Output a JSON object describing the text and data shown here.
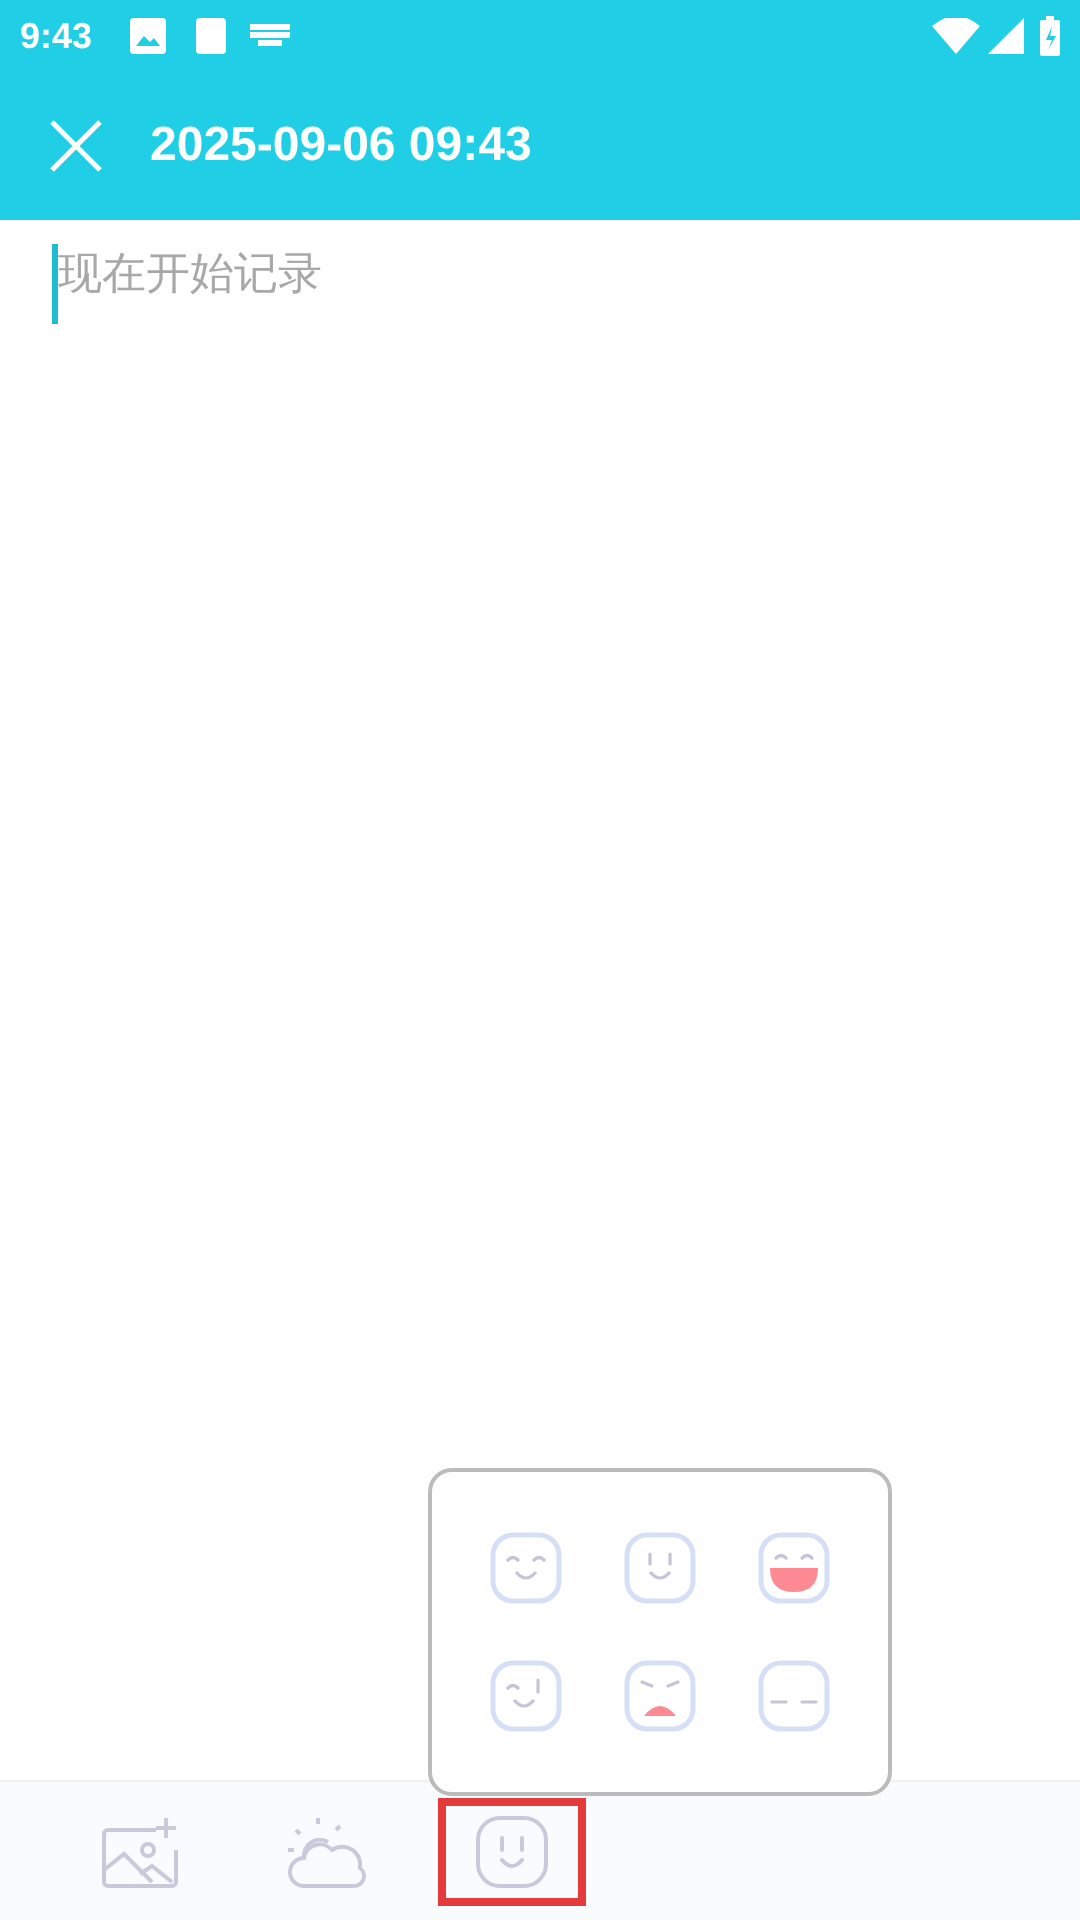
{
  "status_bar": {
    "time": "9:43"
  },
  "header": {
    "title": "2025-09-06 09:43"
  },
  "editor": {
    "placeholder": "现在开始记录"
  },
  "mood_picker": {
    "moods": [
      {
        "kind": "smile"
      },
      {
        "kind": "calm"
      },
      {
        "kind": "laugh"
      },
      {
        "kind": "wink"
      },
      {
        "kind": "cry"
      },
      {
        "kind": "blank"
      }
    ]
  },
  "toolbar": [
    {
      "kind": "image",
      "selected": false
    },
    {
      "kind": "weather",
      "selected": false
    },
    {
      "kind": "mood",
      "selected": true
    }
  ]
}
